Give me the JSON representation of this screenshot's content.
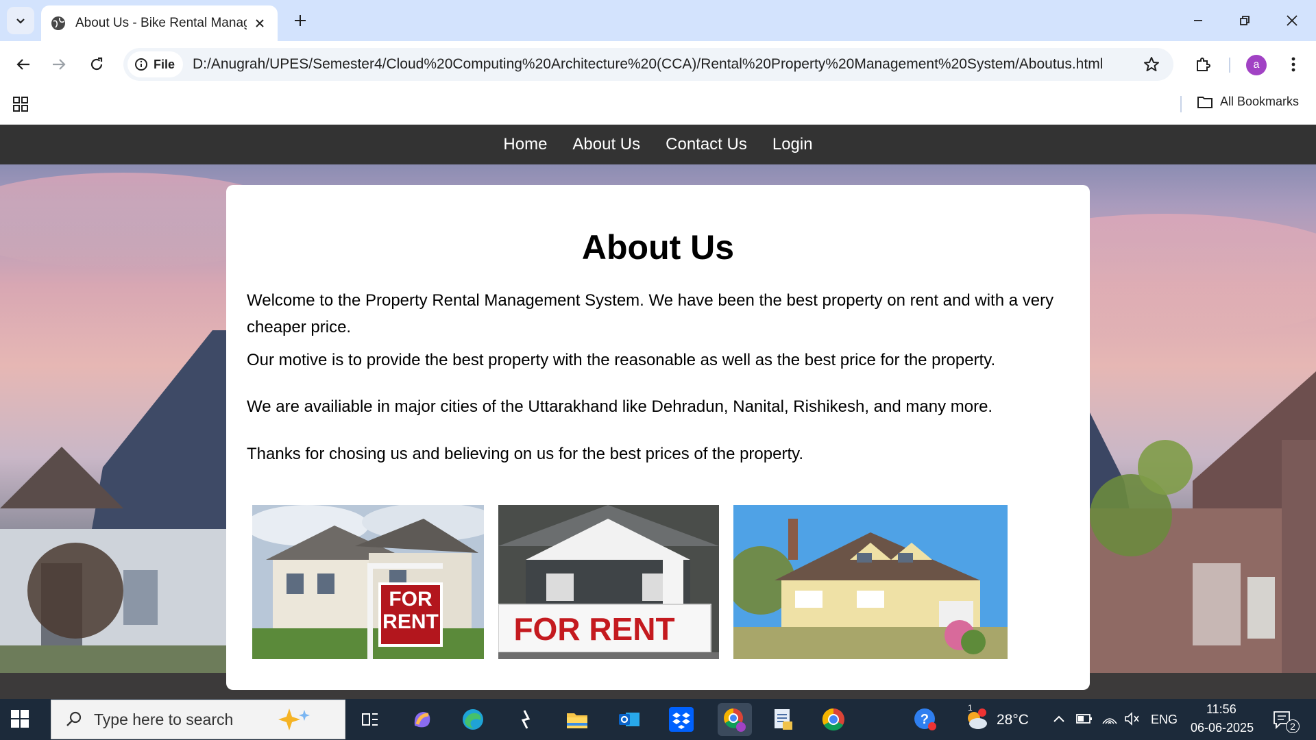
{
  "browser": {
    "tab_title": "About Us - Bike Rental Manage",
    "chip_label": "File",
    "url": "D:/Anugrah/UPES/Semester4/Cloud%20Computing%20Architecture%20(CCA)/Rental%20Property%20Management%20System/Aboutus.html",
    "profile_initial": "a",
    "all_bookmarks": "All Bookmarks"
  },
  "site": {
    "nav": [
      "Home",
      "About Us",
      "Contact Us",
      "Login"
    ],
    "heading": "About Us",
    "paragraphs": [
      "Welcome to the Property Rental Management System. We have been the best property on rent and with a very cheaper price.",
      "Our motive is to provide the best property with the reasonable as well as the best price for the property.",
      "We are availiable in major cities of the Uttarakhand like Dehradun, Nanital, Rishikesh, and many more.",
      "Thanks for chosing us and believing on us for the best prices of the property."
    ],
    "photo_signs": [
      "FOR",
      "RENT",
      "FOR RENT"
    ]
  },
  "taskbar": {
    "search_placeholder": "Type here to search",
    "weather_temp": "28°C",
    "weather_badge": "1",
    "language": "ENG",
    "time": "11:56",
    "date": "06-06-2025",
    "notification_count": "2"
  },
  "colors": {
    "tabbar": "#d3e3fd",
    "sitenav": "#333333",
    "taskbar": "#1c2a3a",
    "avatar": "#a142c4"
  }
}
